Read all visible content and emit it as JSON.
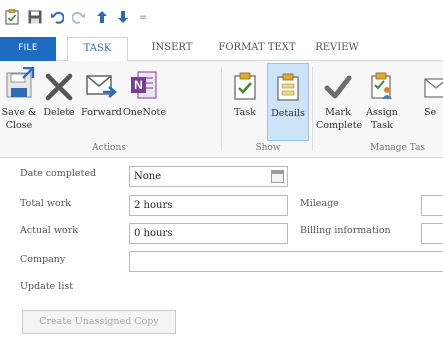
{
  "quick_access": {
    "icons": [
      "task-icon",
      "save-icon",
      "undo-icon",
      "redo-icon",
      "up-arrow-icon",
      "down-arrow-icon",
      "customize-icon"
    ],
    "customize_glyph": "="
  },
  "tabs": [
    {
      "label": "FILE",
      "active": false
    },
    {
      "label": "TASK",
      "active": true
    },
    {
      "label": "INSERT",
      "active": false
    },
    {
      "label": "FORMAT TEXT",
      "active": false
    },
    {
      "label": "REVIEW",
      "active": false
    }
  ],
  "ribbon": {
    "actions": {
      "label": "Actions",
      "buttons": [
        {
          "line1": "Save &",
          "line2": "Close",
          "icon": "save-close-icon"
        },
        {
          "line1": "Delete",
          "line2": "",
          "icon": "delete-icon"
        },
        {
          "line1": "Forward",
          "line2": "",
          "icon": "forward-icon"
        },
        {
          "line1": "OneNote",
          "line2": "",
          "icon": "onenote-icon"
        }
      ]
    },
    "show": {
      "label": "Show",
      "buttons": [
        {
          "line1": "Task",
          "line2": "",
          "icon": "task-icon",
          "pressed": false
        },
        {
          "line1": "Details",
          "line2": "",
          "icon": "details-icon",
          "pressed": true
        }
      ]
    },
    "manage_task": {
      "label": "Manage Tas",
      "buttons": [
        {
          "line1": "Mark",
          "line2": "Complete",
          "icon": "checkmark-icon"
        },
        {
          "line1": "Assign",
          "line2": "Task",
          "icon": "assign-task-icon"
        },
        {
          "line1": "Se",
          "line2": "",
          "icon": "send-status-icon"
        }
      ]
    }
  },
  "form": {
    "date_completed": {
      "label": "Date completed",
      "value": "None"
    },
    "total_work": {
      "label": "Total work",
      "value": "2 hours"
    },
    "actual_work": {
      "label": "Actual work",
      "value": "0 hours"
    },
    "company": {
      "label": "Company",
      "value": ""
    },
    "update_list": {
      "label": "Update list"
    },
    "mileage": {
      "label": "Mileage",
      "value": ""
    },
    "billing_information": {
      "label": "Billing information",
      "value": ""
    },
    "create_unassigned_copy": {
      "label": "Create Unassigned Copy",
      "enabled": false
    }
  },
  "colors": {
    "accent": "#1e6cc1",
    "active_tab_text": "#2a6ab8",
    "pressed_button_bg": "#cde3f7",
    "onenote_purple": "#7b3e98",
    "checkmark_gray": "#6e6e6e"
  }
}
